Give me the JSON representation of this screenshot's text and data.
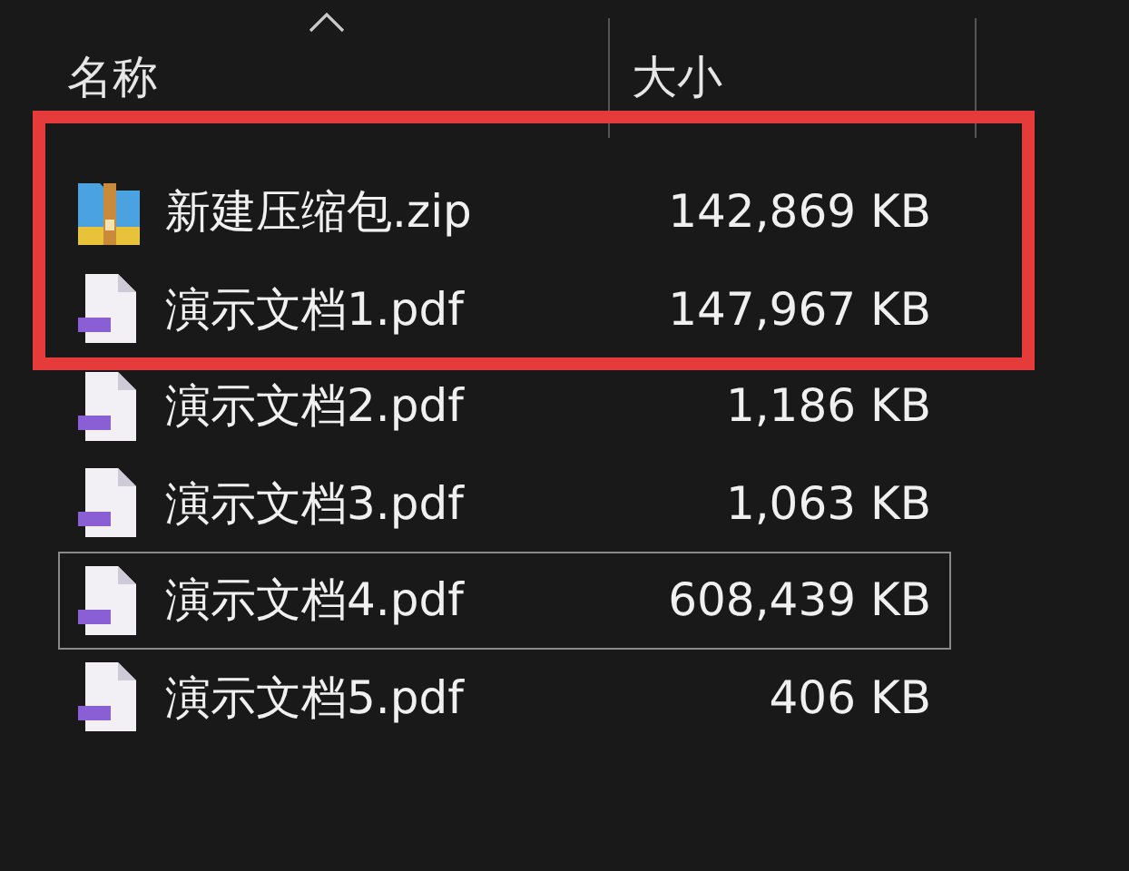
{
  "columns": [
    {
      "label": "名称",
      "sorted": true
    },
    {
      "label": "大小",
      "sorted": false
    }
  ],
  "files": [
    {
      "kind": "zip",
      "name": "新建压缩包.zip",
      "size": "142,869 KB",
      "focused": false,
      "highlighted": true
    },
    {
      "kind": "pdf",
      "name": "演示文档1.pdf",
      "size": "147,967 KB",
      "focused": false,
      "highlighted": true
    },
    {
      "kind": "pdf",
      "name": "演示文档2.pdf",
      "size": "1,186 KB",
      "focused": false,
      "highlighted": false
    },
    {
      "kind": "pdf",
      "name": "演示文档3.pdf",
      "size": "1,063 KB",
      "focused": false,
      "highlighted": false
    },
    {
      "kind": "pdf",
      "name": "演示文档4.pdf",
      "size": "608,439 KB",
      "focused": true,
      "highlighted": false
    },
    {
      "kind": "pdf",
      "name": "演示文档5.pdf",
      "size": "406 KB",
      "focused": false,
      "highlighted": false
    }
  ]
}
